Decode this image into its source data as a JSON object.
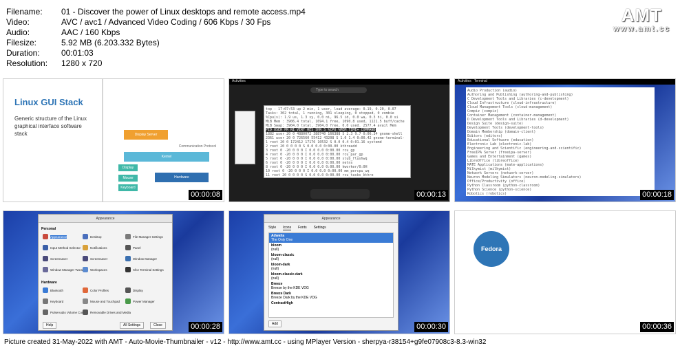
{
  "info": {
    "rows": [
      {
        "key": "Filename:",
        "value": "01 - Discover the power of Linux desktops and remote access.mp4"
      },
      {
        "key": "Video:",
        "value": "AVC / avc1 / Advanced Video Coding / 606 Kbps / 30 Fps"
      },
      {
        "key": "Audio:",
        "value": "AAC / 160 Kbps"
      },
      {
        "key": "Filesize:",
        "value": "5.92 MB (6.203.332 Bytes)"
      },
      {
        "key": "Duration:",
        "value": "00:01:03"
      },
      {
        "key": "Resolution:",
        "value": "1280 x 720"
      }
    ]
  },
  "logo": {
    "big": "AMT",
    "url": "www.amt.cc"
  },
  "thumbs": [
    {
      "timestamp": "00:00:08"
    },
    {
      "timestamp": "00:00:13"
    },
    {
      "timestamp": "00:00:18"
    },
    {
      "timestamp": "00:00:28"
    },
    {
      "timestamp": "00:00:30"
    },
    {
      "timestamp": "00:00:36"
    }
  ],
  "slide": {
    "title": "Linux GUI Stack",
    "desc": "Generic structure of the Linux graphical interface software stack",
    "blocks": {
      "display_server": "Display Server",
      "kernel": "Kernel",
      "hardware": "Hardware",
      "display": "Display",
      "mouse": "Mouse",
      "keyboard": "Keyboard",
      "protocol": "Communication Protocol"
    }
  },
  "t2": {
    "activities": "Activities",
    "search": "Type to search"
  },
  "t3": {
    "activities": "Activities",
    "terminal": "Terminal"
  },
  "t4": {
    "title": "Appearance",
    "personal": "Personal",
    "hardware": "Hardware",
    "help": "Help",
    "all_settings": "All Settings",
    "close": "Close",
    "items": [
      "Appearance",
      "Desktop",
      "File Manager Settings",
      "Input Method Selector",
      "Notifications",
      "Panel",
      "Screensaver",
      "Screensaver",
      "Window Manager",
      "Window Manager Tweaks",
      "Workspaces",
      "Xfce Terminal Settings",
      "Bluetooth",
      "Color Profiles",
      "Display",
      "Keyboard",
      "Mouse and Touchpad",
      "Power Manager",
      "PulseAudio Volume Control",
      "Removable Drives and Media"
    ]
  },
  "t5": {
    "title": "Appearance",
    "tabs": [
      "Style",
      "Icons",
      "Fonts",
      "Settings"
    ],
    "rows": [
      {
        "name": "Adwaita",
        "sub": "The Only One"
      },
      {
        "name": "bloom",
        "sub": "(null)"
      },
      {
        "name": "bloom-classic",
        "sub": "(null)"
      },
      {
        "name": "bloom-dark",
        "sub": "(null)"
      },
      {
        "name": "bloom-classic-dark",
        "sub": "(null)"
      },
      {
        "name": "Breeze",
        "sub": "Breeze by the KDE VDG"
      },
      {
        "name": "Breeze Dark",
        "sub": "Breeze Dark by the KDE VDG"
      },
      {
        "name": "ContrastHigh",
        "sub": ""
      }
    ],
    "add": "Add"
  },
  "t6": {
    "fedora": "Fedora"
  },
  "footer": "Picture created 31-May-2022 with AMT - Auto-Movie-Thumbnailer - v12 - http://www.amt.cc - using MPlayer Version - sherpya-r38154+g9fe07908c3-8.3-win32"
}
